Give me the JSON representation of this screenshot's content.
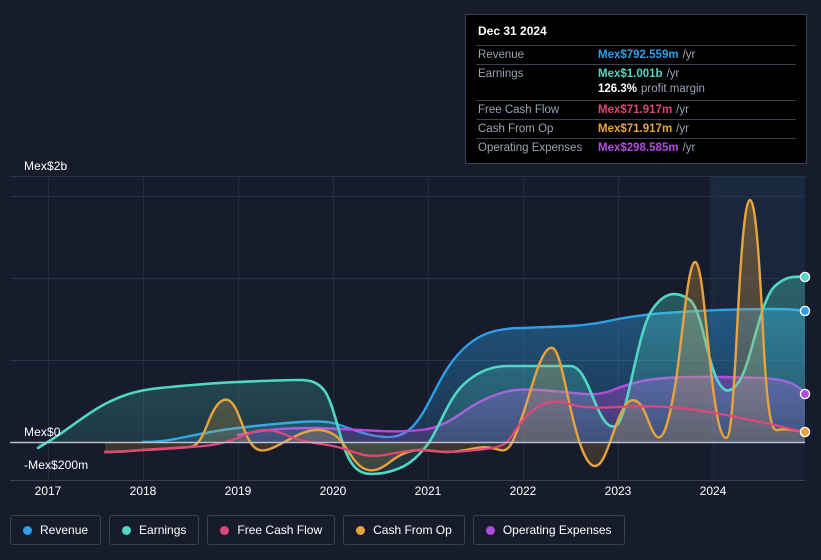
{
  "axes": {
    "y_top_label": "Mex$2b",
    "y_zero_label": "Mex$0",
    "y_neg_label": "-Mex$200m",
    "x_ticks": [
      "2017",
      "2018",
      "2019",
      "2020",
      "2021",
      "2022",
      "2023",
      "2024"
    ]
  },
  "tooltip": {
    "date": "Dec 31 2024",
    "rows": [
      {
        "name": "Revenue",
        "value": "Mex$792.559m",
        "unit": "/yr",
        "color": "#2e9fe8"
      },
      {
        "name": "Earnings",
        "value": "Mex$1.001b",
        "unit": "/yr",
        "color": "#4fd8c4"
      },
      {
        "name": "",
        "value": "126.3%",
        "unit": "profit margin",
        "color": "#ffffff"
      },
      {
        "name": "Free Cash Flow",
        "value": "Mex$71.917m",
        "unit": "/yr",
        "color": "#e0457b"
      },
      {
        "name": "Cash From Op",
        "value": "Mex$71.917m",
        "unit": "/yr",
        "color": "#e8a33d"
      },
      {
        "name": "Operating Expenses",
        "value": "Mex$298.585m",
        "unit": "/yr",
        "color": "#b44ae0"
      }
    ]
  },
  "legend": {
    "items": [
      {
        "label": "Revenue",
        "color": "#2e9fe8"
      },
      {
        "label": "Earnings",
        "color": "#4fd8c4"
      },
      {
        "label": "Free Cash Flow",
        "color": "#e0457b"
      },
      {
        "label": "Cash From Op",
        "color": "#e8a33d"
      },
      {
        "label": "Operating Expenses",
        "color": "#b44ae0"
      }
    ]
  },
  "chart_data": {
    "type": "line",
    "title": "",
    "xlabel": "",
    "ylabel": "",
    "grid": true,
    "legend_position": "bottom",
    "xlim": [
      "2016.6",
      "2025.0"
    ],
    "ylim": [
      -300000000,
      2100000000
    ],
    "y_ticks": [
      2000000000,
      0,
      -200000000
    ],
    "y_tick_labels": [
      "Mex$2b",
      "Mex$0",
      "-Mex$200m"
    ],
    "x_ticks": [
      2017,
      2018,
      2019,
      2020,
      2021,
      2022,
      2023,
      2024
    ],
    "currency_prefix": "Mex$",
    "highlight_band": {
      "from": 2023.97,
      "to": 2025.0,
      "note": "latest-period highlight"
    },
    "x": [
      2016.9,
      2017.0,
      2017.25,
      2017.5,
      2017.75,
      2018.0,
      2018.25,
      2018.5,
      2018.7,
      2018.85,
      2019.0,
      2019.25,
      2019.5,
      2019.75,
      2020.0,
      2020.25,
      2020.5,
      2020.75,
      2021.0,
      2021.25,
      2021.5,
      2021.75,
      2022.0,
      2022.25,
      2022.5,
      2022.75,
      2023.0,
      2023.25,
      2023.5,
      2023.75,
      2024.0,
      2024.25,
      2024.5,
      2024.75,
      2025.0
    ],
    "series": [
      {
        "name": "Revenue",
        "color": "#2e9fe8",
        "values": [
          null,
          null,
          null,
          null,
          null,
          0,
          8000000,
          20000000,
          30000000,
          42000000,
          55000000,
          62000000,
          68000000,
          72000000,
          76000000,
          78000000,
          78000000,
          70000000,
          62000000,
          120000000,
          330000000,
          540000000,
          660000000,
          672000000,
          675000000,
          678000000,
          700000000,
          730000000,
          745000000,
          752000000,
          760000000,
          770000000,
          780000000,
          788000000,
          792559000
        ]
      },
      {
        "name": "Earnings",
        "color": "#4fd8c4",
        "values": [
          -40000000,
          0,
          110000000,
          210000000,
          270000000,
          300000000,
          312000000,
          318000000,
          320000000,
          324000000,
          330000000,
          345000000,
          352000000,
          352000000,
          340000000,
          -20000000,
          -190000000,
          -205000000,
          -180000000,
          10000000,
          270000000,
          290000000,
          290000000,
          285000000,
          120000000,
          300000000,
          680000000,
          710000000,
          250000000,
          120000000,
          480000000,
          960000000,
          1030000000,
          980000000,
          1001000000
        ]
      },
      {
        "name": "Free Cash Flow",
        "color": "#e0457b",
        "values": [
          -60000000,
          -62000000,
          -58000000,
          -54000000,
          -48000000,
          -42000000,
          -34000000,
          -24000000,
          -16000000,
          4000000,
          55000000,
          70000000,
          60000000,
          -10000000,
          -80000000,
          -110000000,
          -95000000,
          -70000000,
          -45000000,
          -30000000,
          -34000000,
          -40000000,
          36000000,
          200000000,
          240000000,
          175000000,
          150000000,
          150000000,
          148000000,
          130000000,
          120000000,
          100000000,
          88000000,
          78000000,
          71917000
        ]
      },
      {
        "name": "Cash From Op",
        "color": "#e8a33d",
        "values": [
          -60000000,
          -62000000,
          -58000000,
          -54000000,
          -48000000,
          -42000000,
          120000000,
          290000000,
          180000000,
          -15000000,
          55000000,
          70000000,
          60000000,
          -10000000,
          -175000000,
          -110000000,
          -95000000,
          -70000000,
          -45000000,
          -30000000,
          -34000000,
          -40000000,
          400000000,
          140000000,
          -250000000,
          40000000,
          1150000000,
          270000000,
          -30000000,
          330000000,
          1650000000,
          200000000,
          130000000,
          95000000,
          71917000
        ]
      },
      {
        "name": "Operating Expenses",
        "color": "#b44ae0",
        "values": [
          null,
          null,
          null,
          null,
          null,
          null,
          null,
          null,
          null,
          null,
          40000000,
          55000000,
          62000000,
          64000000,
          64000000,
          64000000,
          62000000,
          58000000,
          54000000,
          62000000,
          150000000,
          215000000,
          222000000,
          218000000,
          206000000,
          212000000,
          248000000,
          278000000,
          282000000,
          280000000,
          285000000,
          292000000,
          296000000,
          297000000,
          298585000
        ]
      }
    ],
    "endpoints": [
      {
        "name": "Earnings",
        "value": 1001000000,
        "color": "#4fd8c4"
      },
      {
        "name": "Revenue",
        "value": 792559000,
        "color": "#2e9fe8"
      },
      {
        "name": "Operating Expenses",
        "value": 298585000,
        "color": "#b44ae0"
      },
      {
        "name": "Cash From Op",
        "value": 71917000,
        "color": "#e8a33d"
      }
    ]
  }
}
